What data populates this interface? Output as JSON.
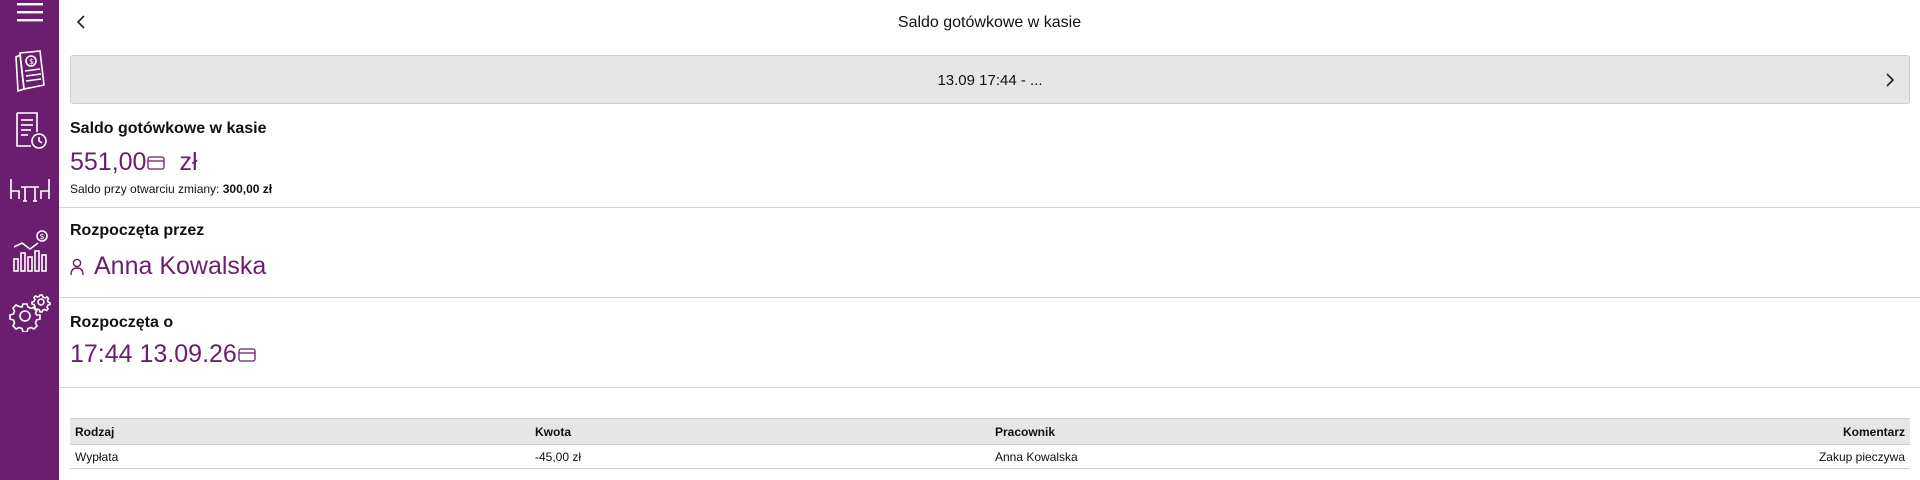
{
  "sidebar": {
    "items": [
      {
        "icon": "menu-icon"
      },
      {
        "icon": "receipt-money-icon"
      },
      {
        "icon": "report-clock-icon"
      },
      {
        "icon": "tables-chairs-icon"
      },
      {
        "icon": "stats-money-icon"
      },
      {
        "icon": "gear-icon"
      }
    ]
  },
  "header": {
    "title": "Saldo gotówkowe w kasie"
  },
  "shift": {
    "range": "13.09 17:44 - ..."
  },
  "balance": {
    "label": "Saldo gotówkowe w kasie",
    "amount": "551,00",
    "currency": "zł",
    "opening_label": "Saldo przy otwarciu zmiany:",
    "opening_value": "300,00 zł"
  },
  "started_by": {
    "label": "Rozpoczęta przez",
    "name": "Anna Kowalska"
  },
  "started_at": {
    "label": "Rozpoczęta o",
    "value": "17:44 13.09.26"
  },
  "table": {
    "headers": {
      "type": "Rodzaj",
      "amount": "Kwota",
      "employee": "Pracownik",
      "comment": "Komentarz"
    },
    "rows": [
      {
        "type": "Wypłata",
        "amount": "-45,00 zł",
        "employee": "Anna Kowalska",
        "comment": "Zakup pieczywa"
      }
    ]
  },
  "colors": {
    "sidebar": "#6b1d6f",
    "accent": "#6b1d6f"
  }
}
